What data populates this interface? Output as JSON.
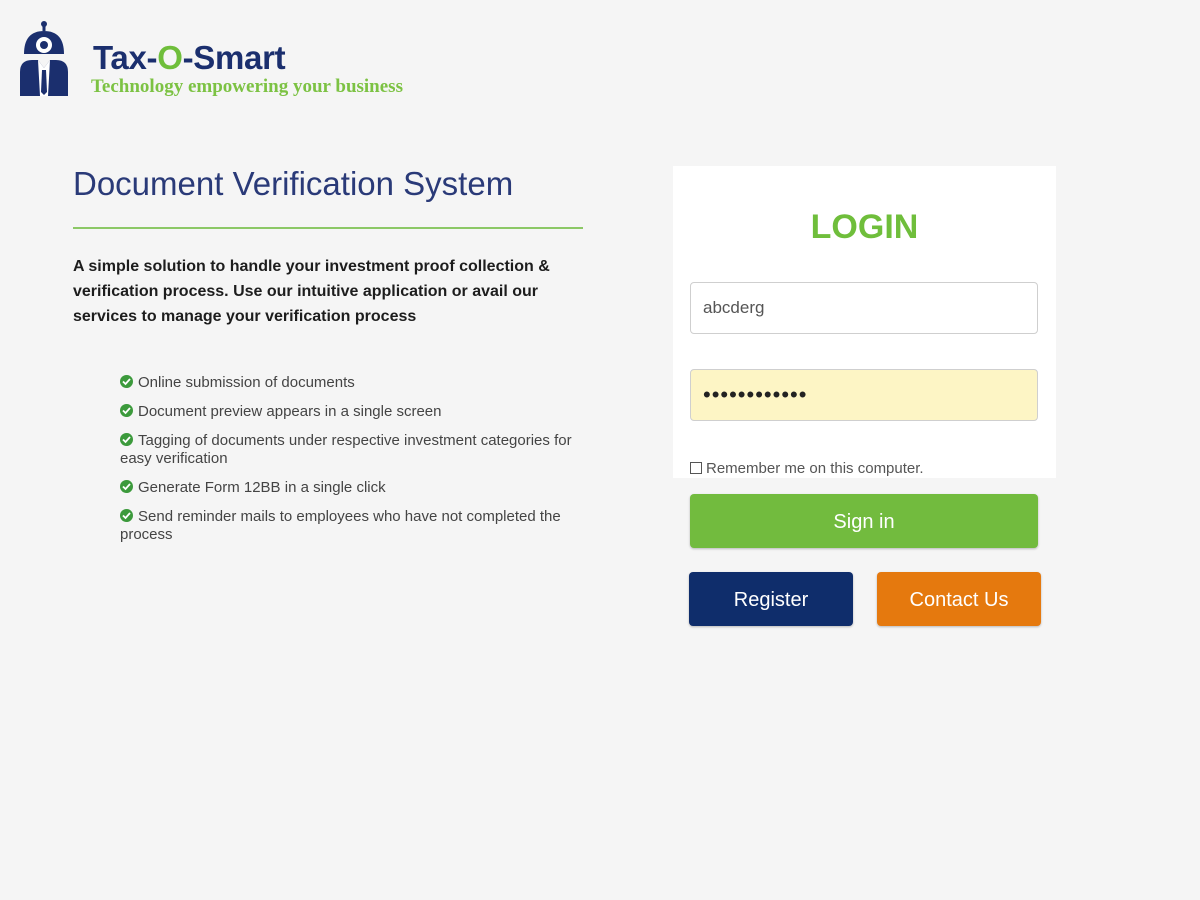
{
  "brand": {
    "name_prefix": "Tax-",
    "name_o": "O",
    "name_suffix": "-Smart",
    "tagline": "Technology empowering your business"
  },
  "colors": {
    "brand_navy": "#1b2f6e",
    "brand_green": "#6fbe3b",
    "signin_green": "#72bb3e",
    "register_navy": "#0f2d6b",
    "contact_orange": "#e5790e",
    "password_fill": "#fdf5c5"
  },
  "left": {
    "title": "Document Verification System",
    "intro": "A simple solution to handle your investment proof collection & verification process. Use our intuitive application or avail our services to manage your verification process",
    "features": [
      "Online submission of documents",
      "Document preview appears in a single screen",
      "Tagging of documents under respective investment categories for easy verification",
      "Generate Form 12BB in a single click",
      "Send reminder mails to employees who have not completed the process"
    ]
  },
  "login": {
    "heading": "LOGIN",
    "username_value": "abcderg",
    "password_value": "••••••••••••",
    "remember_label": "Remember me on this computer.",
    "signin_label": "Sign in",
    "register_label": "Register",
    "contact_label": "Contact Us"
  },
  "icons": {
    "logo": "robot-logo-icon",
    "feature_bullet": "check-circle-icon",
    "remember_checkbox": "checkbox-icon"
  }
}
